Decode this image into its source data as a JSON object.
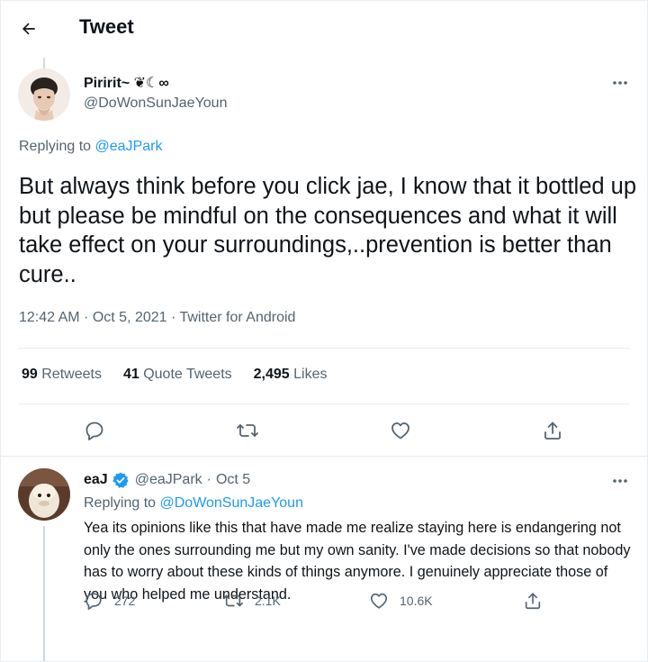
{
  "header": {
    "title": "Tweet",
    "back_icon": "arrow-left-icon"
  },
  "tweet": {
    "author_name": "Piririt~ ❦☾∞",
    "author_handle": "@DoWonSunJaeYoun",
    "replying_prefix": "Replying to",
    "replying_to": "@eaJPark",
    "text": "But always think before you click jae, I know that it bottled up but please be mindful on the consequences and what it will take effect on your surroundings,..prevention is better than cure..",
    "time": "12:42 AM",
    "sep": " · ",
    "date": "Oct 5, 2021",
    "source": "Twitter for Android",
    "stats": {
      "retweets_count": "99",
      "retweets_label": "Retweets",
      "quotes_count": "41",
      "quotes_label": "Quote Tweets",
      "likes_count": "2,495",
      "likes_label": "Likes"
    }
  },
  "reply": {
    "author_name": "eaJ",
    "author_handle": "@eaJPark",
    "sep": "·",
    "date": "Oct 5",
    "replying_prefix": "Replying to",
    "replying_to": "@DoWonSunJaeYoun",
    "text": "Yea its opinions like this that have made me realize staying here is endangering not only the ones surrounding me but my own sanity. I've made decisions so that nobody has to worry about these kinds of things anymore. I genuinely appreciate those of you who helped me understand.",
    "replies": "272",
    "retweets": "2.1K",
    "likes": "10.6K"
  },
  "colors": {
    "accent": "#1d9bf0",
    "secondary_text": "#536471",
    "border": "#e6ecf0"
  }
}
